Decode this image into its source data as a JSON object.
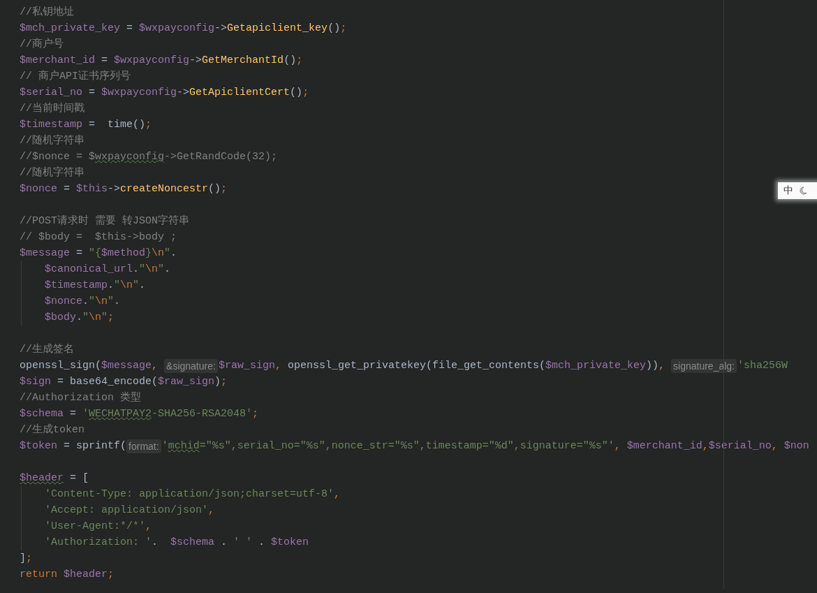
{
  "editor": {
    "lines": [
      {
        "kind": "code",
        "indent": false,
        "tokens": [
          {
            "kind": "comment",
            "text": "//私钥地址"
          }
        ]
      },
      {
        "kind": "code",
        "indent": false,
        "tokens": [
          {
            "kind": "var",
            "text": "$mch_private_key"
          },
          {
            "kind": "plain",
            "text": " = "
          },
          {
            "kind": "var",
            "text": "$wxpayconfig"
          },
          {
            "kind": "plain",
            "text": "->"
          },
          {
            "kind": "func",
            "text": "Getapiclient_key"
          },
          {
            "kind": "plain",
            "text": "()"
          },
          {
            "kind": "op",
            "text": ";"
          }
        ]
      },
      {
        "kind": "code",
        "indent": false,
        "tokens": [
          {
            "kind": "comment",
            "text": "//商户号"
          }
        ]
      },
      {
        "kind": "code",
        "indent": false,
        "tokens": [
          {
            "kind": "var",
            "text": "$merchant_id"
          },
          {
            "kind": "plain",
            "text": " = "
          },
          {
            "kind": "var",
            "text": "$wxpayconfig"
          },
          {
            "kind": "plain",
            "text": "->"
          },
          {
            "kind": "func",
            "text": "GetMerchantId"
          },
          {
            "kind": "plain",
            "text": "()"
          },
          {
            "kind": "op",
            "text": ";"
          }
        ]
      },
      {
        "kind": "code",
        "indent": false,
        "tokens": [
          {
            "kind": "comment",
            "text": "// 商户API证书序列号"
          }
        ]
      },
      {
        "kind": "code",
        "indent": false,
        "tokens": [
          {
            "kind": "var",
            "text": "$serial_no"
          },
          {
            "kind": "plain",
            "text": " = "
          },
          {
            "kind": "var",
            "text": "$wxpayconfig"
          },
          {
            "kind": "plain",
            "text": "->"
          },
          {
            "kind": "func",
            "text": "GetApiclientCert"
          },
          {
            "kind": "plain",
            "text": "()"
          },
          {
            "kind": "op",
            "text": ";"
          }
        ]
      },
      {
        "kind": "code",
        "indent": false,
        "tokens": [
          {
            "kind": "comment",
            "text": "//当前时间戳"
          }
        ]
      },
      {
        "kind": "code",
        "indent": false,
        "tokens": [
          {
            "kind": "var",
            "text": "$timestamp"
          },
          {
            "kind": "plain",
            "text": " =  time()"
          },
          {
            "kind": "op",
            "text": ";"
          }
        ]
      },
      {
        "kind": "code",
        "indent": false,
        "tokens": [
          {
            "kind": "comment",
            "text": "//随机字符串"
          }
        ]
      },
      {
        "kind": "code",
        "indent": false,
        "tokens": [
          {
            "kind": "comment",
            "text": "//$nonce = $"
          },
          {
            "kind": "comment_squiggle",
            "text": "wxpayconfig"
          },
          {
            "kind": "comment",
            "text": "->GetRandCode(32);"
          }
        ]
      },
      {
        "kind": "code",
        "indent": false,
        "tokens": [
          {
            "kind": "comment",
            "text": "//随机字符串"
          }
        ]
      },
      {
        "kind": "code",
        "indent": false,
        "tokens": [
          {
            "kind": "var",
            "text": "$nonce"
          },
          {
            "kind": "plain",
            "text": " = "
          },
          {
            "kind": "var",
            "text": "$this"
          },
          {
            "kind": "plain",
            "text": "->"
          },
          {
            "kind": "func",
            "text": "createNoncestr"
          },
          {
            "kind": "plain",
            "text": "()"
          },
          {
            "kind": "op",
            "text": ";"
          }
        ]
      },
      {
        "kind": "blank"
      },
      {
        "kind": "code",
        "indent": false,
        "tokens": [
          {
            "kind": "comment",
            "text": "//POST请求时 需要 转JSON字符串"
          }
        ]
      },
      {
        "kind": "code",
        "indent": false,
        "tokens": [
          {
            "kind": "comment",
            "text": "// $body =  $this->body ;"
          }
        ]
      },
      {
        "kind": "code",
        "indent": false,
        "tokens": [
          {
            "kind": "var",
            "text": "$message"
          },
          {
            "kind": "plain",
            "text": " = "
          },
          {
            "kind": "string",
            "text": "\"{"
          },
          {
            "kind": "var",
            "text": "$method"
          },
          {
            "kind": "string",
            "text": "}"
          },
          {
            "kind": "op",
            "text": "\\n"
          },
          {
            "kind": "string",
            "text": "\""
          },
          {
            "kind": "plain",
            "text": "."
          }
        ]
      },
      {
        "kind": "code",
        "indent": true,
        "tokens": [
          {
            "kind": "var",
            "text": "$canonical_url"
          },
          {
            "kind": "plain",
            "text": "."
          },
          {
            "kind": "string",
            "text": "\""
          },
          {
            "kind": "op",
            "text": "\\n"
          },
          {
            "kind": "string",
            "text": "\""
          },
          {
            "kind": "plain",
            "text": "."
          }
        ]
      },
      {
        "kind": "code",
        "indent": true,
        "tokens": [
          {
            "kind": "var",
            "text": "$timestamp"
          },
          {
            "kind": "plain",
            "text": "."
          },
          {
            "kind": "string",
            "text": "\""
          },
          {
            "kind": "op",
            "text": "\\n"
          },
          {
            "kind": "string",
            "text": "\""
          },
          {
            "kind": "plain",
            "text": "."
          }
        ]
      },
      {
        "kind": "code",
        "indent": true,
        "tokens": [
          {
            "kind": "var",
            "text": "$nonce"
          },
          {
            "kind": "plain",
            "text": "."
          },
          {
            "kind": "string",
            "text": "\""
          },
          {
            "kind": "op",
            "text": "\\n"
          },
          {
            "kind": "string",
            "text": "\""
          },
          {
            "kind": "plain",
            "text": "."
          }
        ]
      },
      {
        "kind": "code",
        "indent": true,
        "tokens": [
          {
            "kind": "var",
            "text": "$body"
          },
          {
            "kind": "plain",
            "text": "."
          },
          {
            "kind": "string",
            "text": "\""
          },
          {
            "kind": "op",
            "text": "\\n"
          },
          {
            "kind": "string",
            "text": "\""
          },
          {
            "kind": "op",
            "text": ";"
          }
        ]
      },
      {
        "kind": "blank"
      },
      {
        "kind": "code",
        "indent": false,
        "tokens": [
          {
            "kind": "comment",
            "text": "//生成签名"
          }
        ]
      },
      {
        "kind": "code",
        "indent": false,
        "tokens": [
          {
            "kind": "plain",
            "text": "openssl_sign("
          },
          {
            "kind": "var",
            "text": "$message"
          },
          {
            "kind": "op",
            "text": ", "
          },
          {
            "kind": "hint",
            "text": "&signature:"
          },
          {
            "kind": "var",
            "text": "$raw_sign"
          },
          {
            "kind": "op",
            "text": ", "
          },
          {
            "kind": "plain",
            "text": "openssl_get_privatekey(file_get_contents("
          },
          {
            "kind": "var",
            "text": "$mch_private_key"
          },
          {
            "kind": "plain",
            "text": "))"
          },
          {
            "kind": "op",
            "text": ", "
          },
          {
            "kind": "hint",
            "text": "signature_alg:"
          },
          {
            "kind": "string",
            "text": "'sha256W"
          }
        ]
      },
      {
        "kind": "code",
        "indent": false,
        "tokens": [
          {
            "kind": "var",
            "text": "$sign"
          },
          {
            "kind": "plain",
            "text": " = base64_encode("
          },
          {
            "kind": "var",
            "text": "$raw_sign"
          },
          {
            "kind": "plain",
            "text": ")"
          },
          {
            "kind": "op",
            "text": ";"
          }
        ]
      },
      {
        "kind": "code",
        "indent": false,
        "tokens": [
          {
            "kind": "comment",
            "text": "//Authorization 类型"
          }
        ]
      },
      {
        "kind": "code",
        "indent": false,
        "tokens": [
          {
            "kind": "var",
            "text": "$schema"
          },
          {
            "kind": "plain",
            "text": " = "
          },
          {
            "kind": "string",
            "text": "'"
          },
          {
            "kind": "string_squiggle",
            "text": "WECHATPAY2"
          },
          {
            "kind": "string",
            "text": "-SHA256-RSA2048'"
          },
          {
            "kind": "op",
            "text": ";"
          }
        ]
      },
      {
        "kind": "code",
        "indent": false,
        "tokens": [
          {
            "kind": "comment",
            "text": "//生成token"
          }
        ]
      },
      {
        "kind": "code",
        "indent": false,
        "tokens": [
          {
            "kind": "var",
            "text": "$token"
          },
          {
            "kind": "plain",
            "text": " = sprintf("
          },
          {
            "kind": "hint",
            "text": "format:"
          },
          {
            "kind": "string",
            "text": "'"
          },
          {
            "kind": "string_squiggle",
            "text": "mchid"
          },
          {
            "kind": "string",
            "text": "=\"%s\",serial_no=\"%s\",nonce_str=\"%s\",timestamp=\"%d\",signature=\"%s\"'"
          },
          {
            "kind": "op",
            "text": ", "
          },
          {
            "kind": "var",
            "text": "$merchant_id"
          },
          {
            "kind": "op",
            "text": ","
          },
          {
            "kind": "var",
            "text": "$serial_no"
          },
          {
            "kind": "op",
            "text": ", "
          },
          {
            "kind": "var",
            "text": "$non"
          }
        ]
      },
      {
        "kind": "blank"
      },
      {
        "kind": "code",
        "indent": false,
        "tokens": [
          {
            "kind": "var_squiggle",
            "text": "$header"
          },
          {
            "kind": "plain",
            "text": " = ["
          }
        ]
      },
      {
        "kind": "code",
        "indent": true,
        "tokens": [
          {
            "kind": "string",
            "text": "'Content-Type: application/json;charset=utf-8'"
          },
          {
            "kind": "op",
            "text": ","
          }
        ]
      },
      {
        "kind": "code",
        "indent": true,
        "tokens": [
          {
            "kind": "string",
            "text": "'Accept: application/json'"
          },
          {
            "kind": "op",
            "text": ","
          }
        ]
      },
      {
        "kind": "code",
        "indent": true,
        "tokens": [
          {
            "kind": "string",
            "text": "'User-Agent:*/*'"
          },
          {
            "kind": "op",
            "text": ","
          }
        ]
      },
      {
        "kind": "code",
        "indent": true,
        "tokens": [
          {
            "kind": "string",
            "text": "'Authorization: '"
          },
          {
            "kind": "plain",
            "text": ".  "
          },
          {
            "kind": "var",
            "text": "$schema"
          },
          {
            "kind": "plain",
            "text": " . "
          },
          {
            "kind": "string",
            "text": "' '"
          },
          {
            "kind": "plain",
            "text": " . "
          },
          {
            "kind": "var",
            "text": "$token"
          }
        ]
      },
      {
        "kind": "code",
        "indent": false,
        "tokens": [
          {
            "kind": "plain",
            "text": "]"
          },
          {
            "kind": "op",
            "text": ";"
          }
        ]
      },
      {
        "kind": "code",
        "indent": false,
        "tokens": [
          {
            "kind": "keyword",
            "text": "return "
          },
          {
            "kind": "var",
            "text": "$header"
          },
          {
            "kind": "op",
            "text": ";"
          }
        ]
      }
    ]
  },
  "ime": {
    "label": "中"
  }
}
